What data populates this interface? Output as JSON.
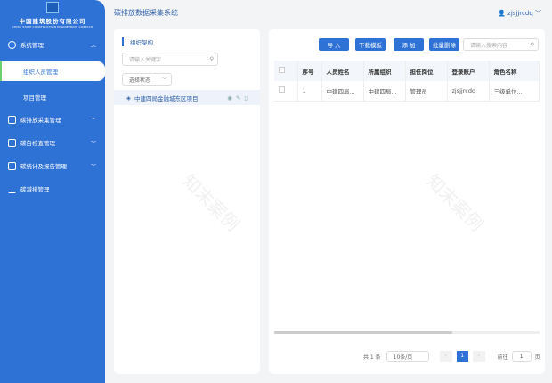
{
  "brand": {
    "name_cn": "中国建筑股份有限公司",
    "name_en": "CHINA STATE CONSTRUCTION ENGINEERING CORP.LTD"
  },
  "sidebar": {
    "items": [
      {
        "label": "系统管理",
        "icon": "gear-icon",
        "expanded": true
      },
      {
        "label": "组织人员管理",
        "active": true
      },
      {
        "label": "项目管理"
      },
      {
        "label": "碳排放采集管理",
        "icon": "collect-icon"
      },
      {
        "label": "碳自检查管理",
        "icon": "check-icon"
      },
      {
        "label": "碳统计及报告管理",
        "icon": "report-icon"
      },
      {
        "label": "碳减排管理",
        "icon": "bar-chart-icon"
      }
    ]
  },
  "header": {
    "title": "碳排放数据采集系统",
    "user": "zjsjjrcdq"
  },
  "left": {
    "title": "组织架构",
    "search_placeholder": "请输入关键字",
    "status_placeholder": "选择状态",
    "tree_item": "中建四局金融城东区项目"
  },
  "toolbar": {
    "import": "导 入",
    "download": "下载模板",
    "add": "添 加",
    "batch_delete": "批量删除",
    "search_placeholder": "请输入搜索内容"
  },
  "table": {
    "columns": [
      "序号",
      "人员姓名",
      "所属组织",
      "担任岗位",
      "登录账户",
      "角色名称"
    ],
    "rows": [
      [
        "1",
        "中建四局...",
        "中建四局...",
        "管理员",
        "zjsjjrcdq",
        "三级单位..."
      ]
    ]
  },
  "pagination": {
    "total": "共 1 条",
    "page_size": "10条/页",
    "current": "1",
    "goto_label": "前往",
    "goto_value": "1",
    "page_unit": "页"
  },
  "watermark": "知末案例",
  "colors": {
    "primary": "#2f72d6"
  }
}
